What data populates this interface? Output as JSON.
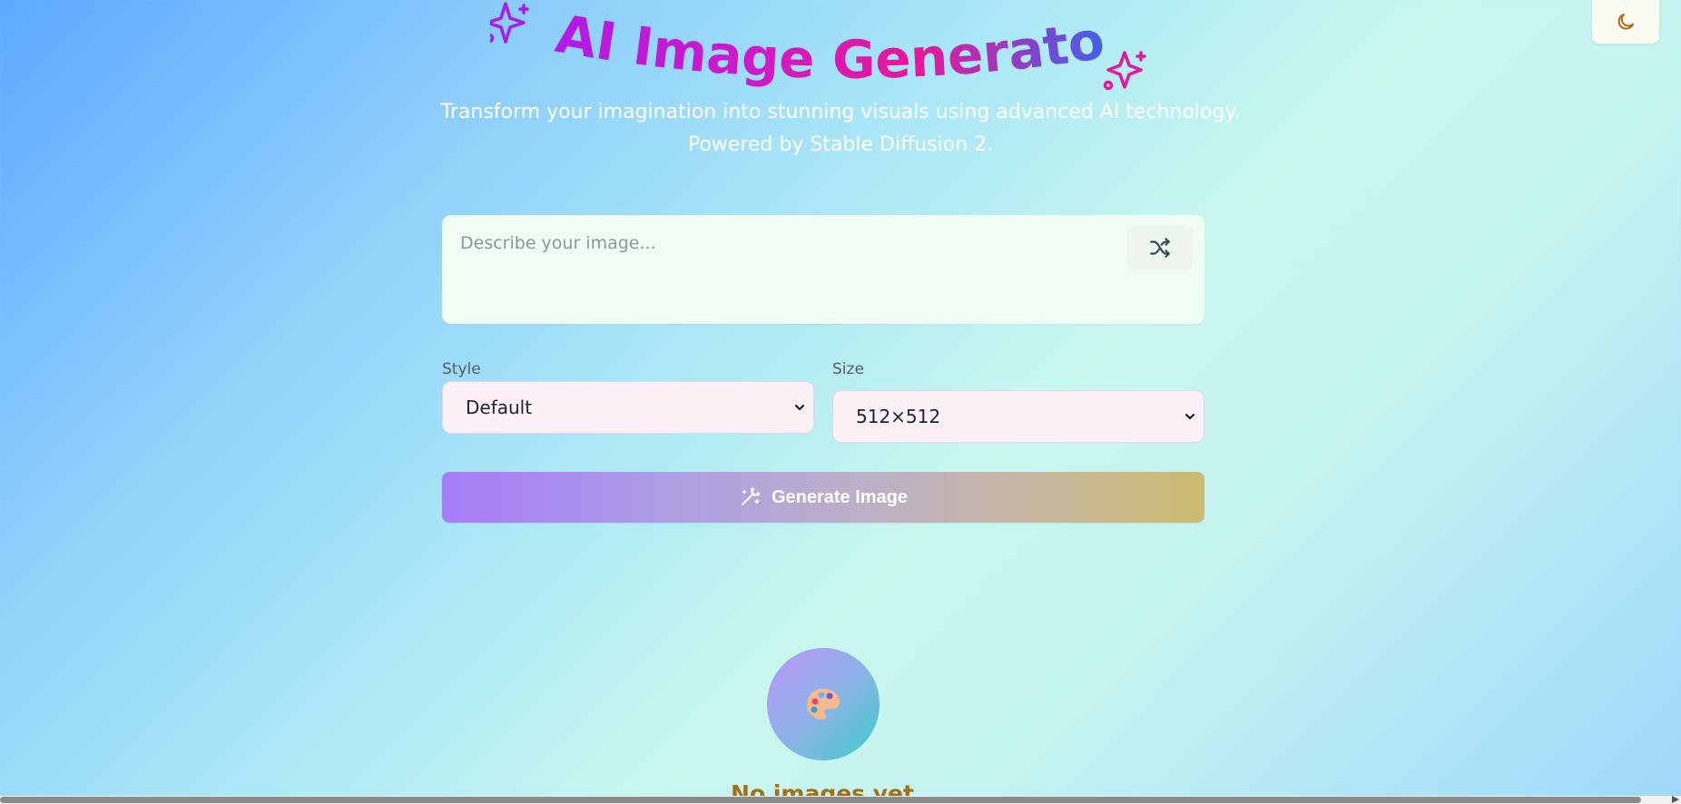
{
  "header": {
    "title": "AI Image Generator",
    "subtitle_line1": "Transform your imagination into stunning visuals using advanced AI technology.",
    "subtitle_line2": "Powered by Stable Diffusion 2.",
    "theme_toggle_icon": "moon-icon",
    "title_icon": "sparkles-icon"
  },
  "prompt": {
    "value": "",
    "placeholder": "Describe your image...",
    "shuffle_icon": "shuffle-icon"
  },
  "style_field": {
    "label": "Style",
    "selected": "Default"
  },
  "size_field": {
    "label": "Size",
    "selected": "512×512"
  },
  "generate_button": {
    "label": "Generate Image",
    "icon": "magic-wand-icon"
  },
  "empty_state": {
    "icon": "palette-icon",
    "title": "No images yet"
  },
  "colors": {
    "title_gradient": [
      "#a81bf0",
      "#d61ac0",
      "#e3189e",
      "#4f5ee8"
    ],
    "accent_orange": "#a36f18",
    "button_gradient": [
      "#a77cf8",
      "#cbbb70"
    ]
  }
}
